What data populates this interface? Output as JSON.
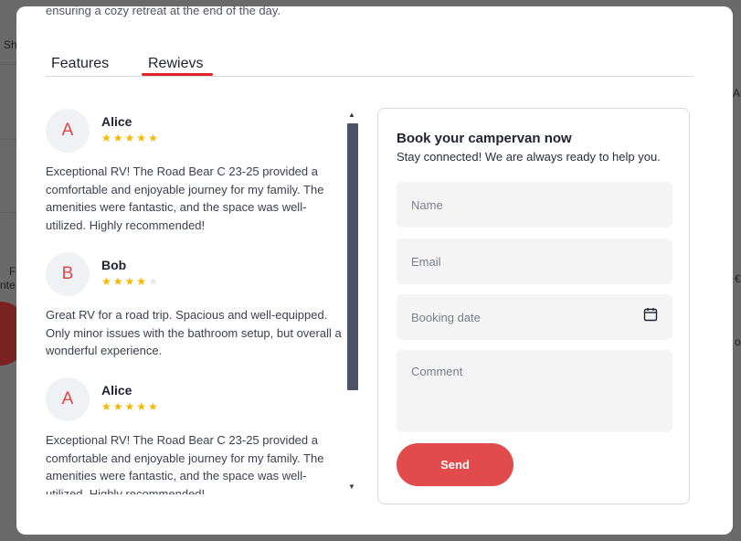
{
  "modal": {
    "intro_text": "ensuring a cozy retreat at the end of the day."
  },
  "tabs": {
    "features": "Features",
    "reviews": "Rewievs",
    "active": "reviews"
  },
  "reviews": [
    {
      "initial": "A",
      "name": "Alice",
      "rating": 5,
      "text": "Exceptional RV! The Road Bear C 23-25 provided a comfortable and enjoyable journey for my family. The amenities were fantastic, and the space was well-utilized. Highly recommended!"
    },
    {
      "initial": "B",
      "name": "Bob",
      "rating": 4,
      "text": "Great RV for a road trip. Spacious and well-equipped. Only minor issues with the bathroom setup, but overall a wonderful experience."
    },
    {
      "initial": "A",
      "name": "Alice",
      "rating": 5,
      "text": "Exceptional RV! The Road Bear C 23-25 provided a comfortable and enjoyable journey for my family. The amenities were fantastic, and the space was well-utilized. Highly recommended!"
    }
  ],
  "booking": {
    "title": "Book your campervan now",
    "subtitle": "Stay connected! We are always ready to help you.",
    "name_placeholder": "Name",
    "email_placeholder": "Email",
    "date_placeholder": "Booking date",
    "comment_placeholder": "Comment",
    "send_label": "Send",
    "calendar_icon": "calendar-icon"
  },
  "colors": {
    "accent": "#e0242e",
    "button": "#e24b4b",
    "star": "#f5b800",
    "avatar_text": "#e04646"
  },
  "backdrop": {
    "fragments": [
      "Sh",
      "F",
      "nte",
      "€",
      "o",
      "AC"
    ]
  }
}
